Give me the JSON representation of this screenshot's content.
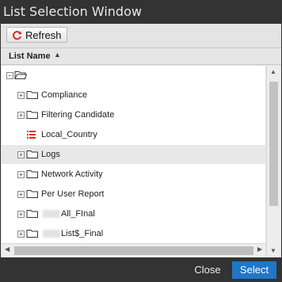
{
  "window": {
    "title": "List Selection Window"
  },
  "toolbar": {
    "refresh_label": "Refresh",
    "refresh_icon": "refresh-icon",
    "refresh_icon_color": "#d8322b"
  },
  "column": {
    "header": "List Name",
    "sort_indicator": "^"
  },
  "tree": {
    "root": {
      "icon": "open-folder-icon"
    },
    "items": [
      {
        "label": "Compliance",
        "type": "folder",
        "expandable": true,
        "selected": false
      },
      {
        "label": "Filtering Candidate",
        "type": "folder",
        "expandable": true,
        "selected": false
      },
      {
        "label": "Local_Country",
        "type": "list",
        "expandable": false,
        "selected": false
      },
      {
        "label": "Logs",
        "type": "folder",
        "expandable": true,
        "selected": true
      },
      {
        "label": "Network Activity",
        "type": "folder",
        "expandable": true,
        "selected": false
      },
      {
        "label": "Per User Report",
        "type": "folder",
        "expandable": true,
        "selected": false
      },
      {
        "label": "All_FInal",
        "type": "folder",
        "expandable": true,
        "selected": false,
        "redacted_prefix": true
      },
      {
        "label": "List$_Final",
        "type": "folder",
        "expandable": true,
        "selected": false,
        "redacted_prefix": true
      }
    ]
  },
  "buttons": {
    "close": "Close",
    "select": "Select"
  },
  "colors": {
    "accent": "#1f77c9",
    "title_bar": "#333333",
    "panel": "#e4e4e4"
  }
}
